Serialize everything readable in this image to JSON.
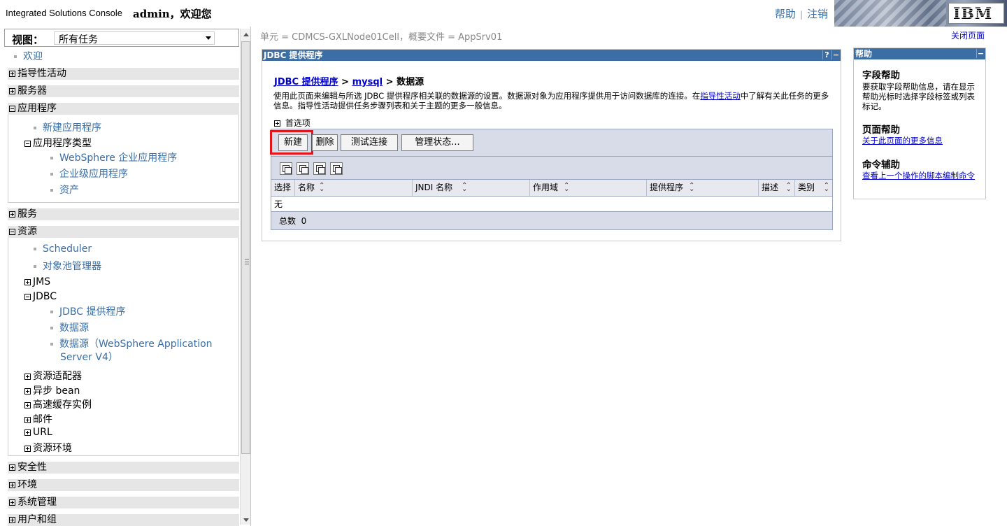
{
  "header": {
    "app_title": "Integrated Solutions Console",
    "welcome": "admin，欢迎您",
    "help_link": "帮助",
    "logout_link": "注销",
    "logo": "IBM"
  },
  "nav": {
    "view_label": "视图：",
    "view_value": "所有任务",
    "welcome": "欢迎",
    "sections": {
      "guided": "指导性活动",
      "servers": "服务器",
      "applications": "应用程序",
      "services": "服务",
      "resources": "资源",
      "security": "安全性",
      "environment": "环境",
      "sysadmin": "系统管理",
      "users": "用户和组"
    },
    "app_items": {
      "new_app": "新建应用程序",
      "app_types": "应用程序类型",
      "websphere_apps": "WebSphere 企业应用程序",
      "enterprise_apps": "企业级应用程序",
      "assets": "资产"
    },
    "res_items": {
      "scheduler": "Scheduler",
      "pool_mgr": "对象池管理器",
      "jms": "JMS",
      "jdbc": "JDBC",
      "jdbc_providers": "JDBC 提供程序",
      "datasources": "数据源",
      "datasources_v4_line1": "数据源（WebSphere Application",
      "datasources_v4_line2": "Server V4）",
      "adapters": "资源适配器",
      "async": "异步 bean",
      "cache": "高速缓存实例",
      "mail": "邮件",
      "url": "URL",
      "res_env": "资源环境"
    }
  },
  "main": {
    "scope": "单元 = CDMCS-GXLNode01Cell，概要文件 = AppSrv01",
    "close_page": "关闭页面",
    "portlet_title": "JDBC 提供程序",
    "portlet_help_btn": "?",
    "portlet_min_btn": "−",
    "crumb1": "JDBC 提供程序",
    "crumb_sep": ">",
    "crumb2": "mysql",
    "crumb3": "数据源",
    "desc_pre": "使用此页面来编辑与所选 JDBC 提供程序相关联的数据源的设置。数据源对象为应用程序提供用于访问数据库的连接。在",
    "desc_link": "指导性活动",
    "desc_post": "中了解有关此任务的更多信息。指导性活动提供任务步骤列表和关于主题的更多一般信息。",
    "prefs": "首选项",
    "buttons": {
      "new": "新建",
      "delete": "删除",
      "test": "测试连接",
      "manage": "管理状态..."
    },
    "columns": [
      "选择",
      "名称",
      "JNDI 名称",
      "作用域",
      "提供程序",
      "描述",
      "类别"
    ],
    "empty_row": "无",
    "total_label": "总数",
    "total_value": "0"
  },
  "help": {
    "title": "帮助",
    "field_help_title": "字段帮助",
    "field_help_text": "要获取字段帮助信息，请在显示帮助光标时选择字段标签或列表标记。",
    "page_help_title": "页面帮助",
    "page_help_link": "关于此页面的更多信息",
    "cmd_title": "命令辅助",
    "cmd_link": "查看上一个操作的脚本编制命令"
  }
}
